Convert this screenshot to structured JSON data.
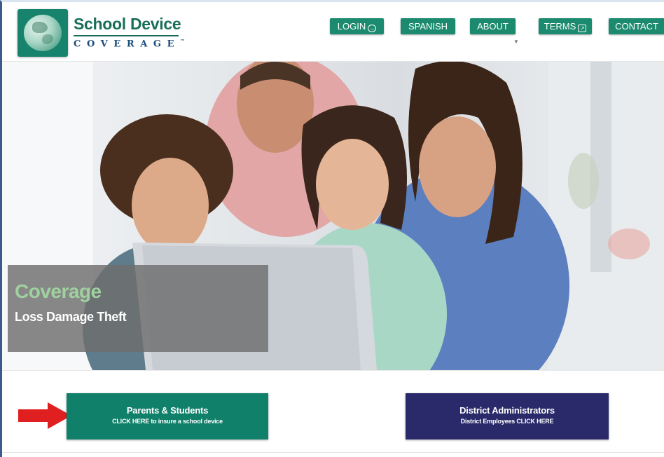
{
  "brand": {
    "title": "School Device",
    "subtitle": "COVERAGE",
    "trademark": "™"
  },
  "nav": {
    "login": "LOGIN",
    "spanish": "SPANISH",
    "about": "ABOUT",
    "terms": "TERMS",
    "contact": "CONTACT"
  },
  "hero": {
    "title": "Coverage",
    "subtitle": "Loss Damage Theft"
  },
  "cta": {
    "parents_title": "Parents & Students",
    "parents_sub": "CLICK HERE to insure a school device",
    "admin_title": "District Administrators",
    "admin_sub": "District Employees CLICK HERE"
  },
  "colors": {
    "brand_green": "#1b8a6e",
    "parents_button": "#10806a",
    "admin_button": "#2a2a6a",
    "caption_green": "#9fd19f",
    "arrow_red": "#e02020"
  },
  "icons": {
    "login": "sign-in-icon",
    "terms": "document-icon",
    "about": "caret-down-icon"
  }
}
